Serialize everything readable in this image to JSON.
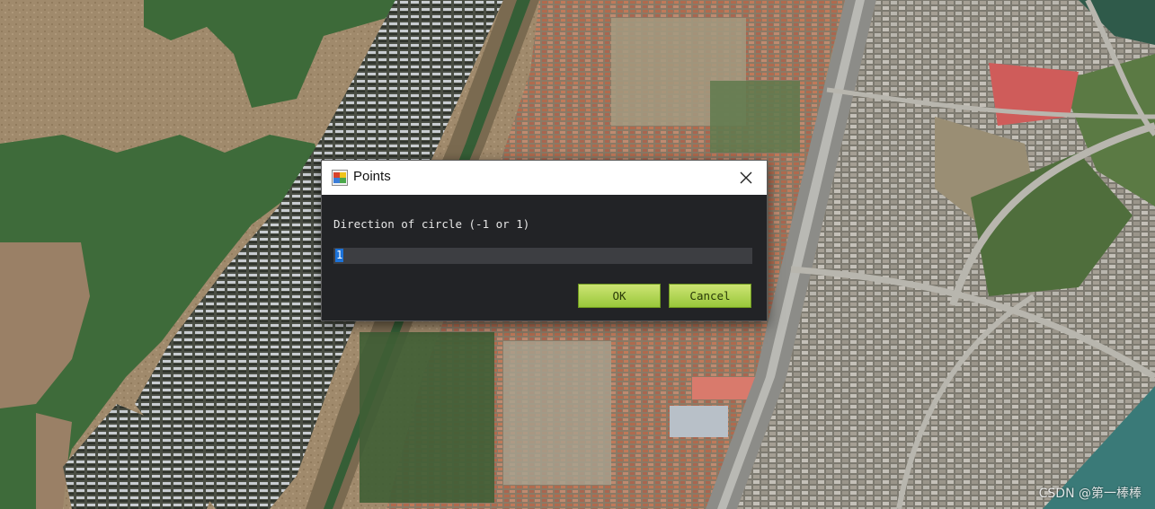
{
  "dialog": {
    "title": "Points",
    "prompt": "Direction of circle (-1 or 1)",
    "input_value": "1",
    "ok_label": "OK",
    "cancel_label": "Cancel"
  },
  "watermark": "CSDN @第一棒棒",
  "icons": {
    "app": "app-window-icon",
    "close": "close-icon"
  },
  "colors": {
    "dialog_bg": "#222326",
    "titlebar_bg": "#ffffff",
    "button_green": "#b3d651",
    "selection_blue": "#1c72d8",
    "water": "#3f6b3a",
    "dry_land": "#9a8468"
  }
}
